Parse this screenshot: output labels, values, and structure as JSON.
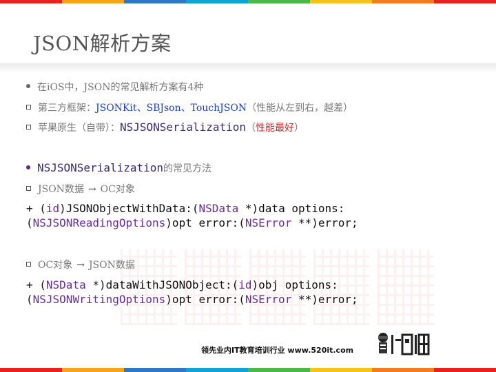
{
  "colors": {
    "stripe": [
      "#e8211e",
      "#f8a41b",
      "#2e78c7",
      "#12a3d6",
      "#4bb848",
      "#f6c31b",
      "#f47b20",
      "#e8211e"
    ],
    "accent_blue": "#1a3fc9",
    "accent_red": "#e02020",
    "keyword_purple": "#6a2aa0"
  },
  "title": "JSON解析方案",
  "lines": {
    "l1": "在iOS中，JSON的常见解析方案有4种",
    "l2_prefix": "第三方框架：",
    "l2_libs": "JSONKit、SBJson、TouchJSON",
    "l2_suffix": "（性能从左到右，越差）",
    "l3_prefix": "苹果原生（自带）：",
    "l3_api": "NSJSONSerialization",
    "l3_open": "（",
    "l3_note": "性能最好",
    "l3_close": "）",
    "l4_api": "NSJSONSerialization",
    "l4_suffix": "的常见方法",
    "l5_from": "JSON数据",
    "l5_to": "OC对象",
    "l6_from": "OC对象",
    "l6_to": "JSON数据",
    "arrow_glyph": "→"
  },
  "code1": {
    "a": "+ (",
    "b": "id",
    "c": ")JSONObjectWithData:(",
    "d": "NSData",
    "e": " *)data options:",
    "f": "(",
    "g": "NSJSONReadingOptions",
    "h": ")opt error:(",
    "i": "NSError",
    "j": " **)error;"
  },
  "code2": {
    "a": "+ (",
    "b": "NSData",
    "c": " *)dataWithJSONObject:(",
    "d": "id",
    "e": ")obj options:",
    "f": "(",
    "g": "NSJSONWritingOptions",
    "h": ")opt error:(",
    "i": "NSError",
    "j": " **)error;"
  },
  "footer": {
    "text": "领先业内IT教育培训行业 www.520it.com",
    "logo_icon": "brand-logo-icon"
  }
}
